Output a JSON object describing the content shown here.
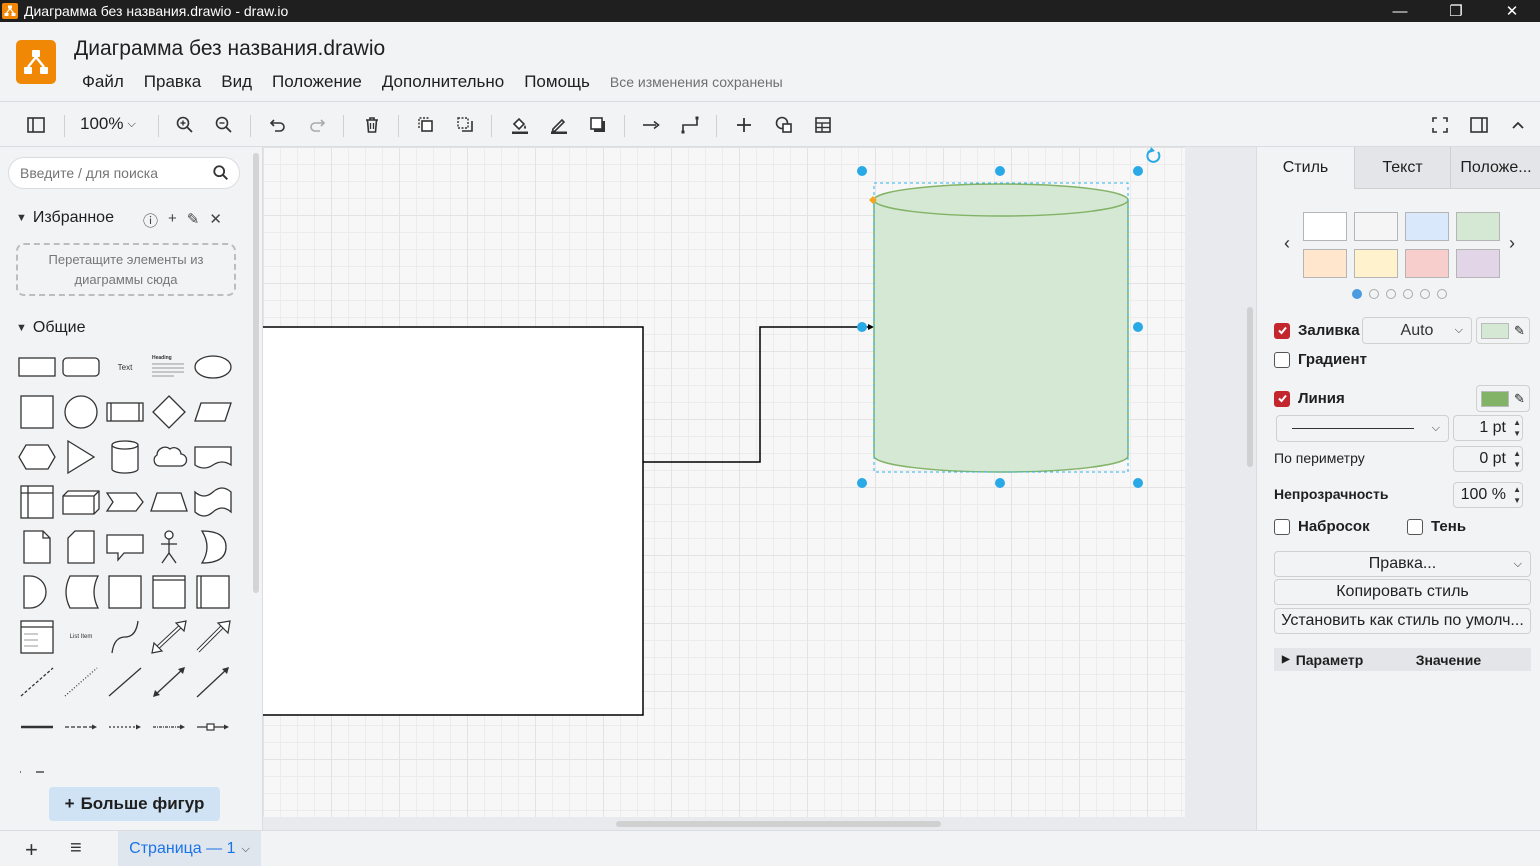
{
  "window": {
    "title": "Диаграмма без названия.drawio - draw.io",
    "minimize": "—",
    "maximize": "❐",
    "close": "✕"
  },
  "header": {
    "doc_title": "Диаграмма без названия.drawio",
    "menus": [
      "Файл",
      "Правка",
      "Вид",
      "Положение",
      "Дополнительно",
      "Помощь"
    ],
    "save_status": "Все изменения сохранены"
  },
  "toolbar": {
    "zoom": "100%",
    "icons": [
      "sidebar-toggle-icon",
      "zoom-in-icon",
      "zoom-out-icon",
      "undo-icon",
      "redo-icon",
      "delete-icon",
      "to-front-icon",
      "to-back-icon",
      "fill-color-icon",
      "line-color-icon",
      "shadow-icon",
      "connection-icon",
      "waypoints-icon",
      "insert-icon",
      "shapes-icon",
      "table-icon",
      "fullscreen-icon",
      "format-panel-icon",
      "collapse-icon"
    ]
  },
  "left_panel": {
    "search_placeholder": "Введите / для поиска",
    "favorites_title": "Избранное",
    "favorites_drop": "Перетащите элементы из диаграммы сюда",
    "general_title": "Общие",
    "shape_text_label": "Text",
    "shape_heading_label": "Heading",
    "shape_list_item_label": "List Item",
    "more_shapes": "Больше фигур"
  },
  "right_panel": {
    "tabs": [
      "Стиль",
      "Текст",
      "Положе..."
    ],
    "swatch_colors": [
      "#ffffff",
      "#f5f5f5",
      "#dae8fc",
      "#d5e8d4",
      "#ffe6cc",
      "#fff2cc",
      "#f8cecc",
      "#e1d5e7"
    ],
    "fill_label": "Заливка",
    "fill_mode": "Auto",
    "fill_color": "#d5e8d4",
    "gradient_label": "Градиент",
    "line_label": "Линия",
    "line_color": "#82b366",
    "line_width": "1 pt",
    "perimeter_label": "По периметру",
    "perimeter_value": "0 pt",
    "opacity_label": "Непрозрачность",
    "opacity_value": "100 %",
    "sketch_label": "Набросок",
    "shadow_label": "Тень",
    "edit_button": "Правка...",
    "copy_style_button": "Копировать стиль",
    "set_default_button": "Установить как стиль по умолч...",
    "table_param": "Параметр",
    "table_value": "Значение"
  },
  "bottom": {
    "page_tab": "Страница — 1"
  }
}
